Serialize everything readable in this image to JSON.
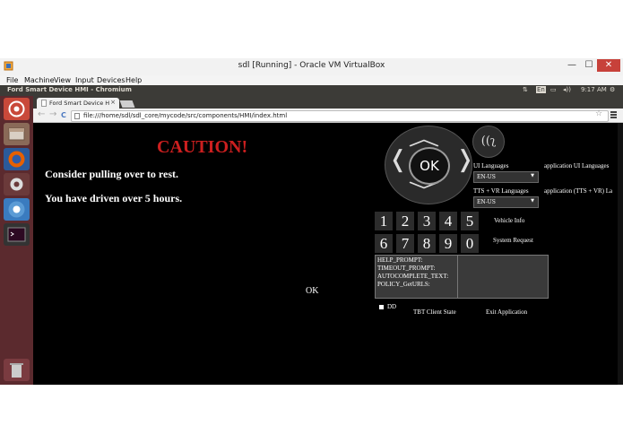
{
  "vbox": {
    "title": "sdl [Running] - Oracle VM VirtualBox",
    "menu": [
      "File",
      "Machine",
      "View",
      "Input",
      "Devices",
      "Help"
    ],
    "min_glyph": "—",
    "max_glyph": "☐",
    "close_glyph": "✕"
  },
  "ubuntu": {
    "window_title": "Ford Smart Device HMI - Chromium",
    "keyboard_indicator": "En",
    "clock": "9:17 AM",
    "network_glyph": "⇅",
    "battery_glyph": "▭",
    "volume_glyph": "◂))",
    "settings_glyph": "⚙"
  },
  "browser": {
    "tab_title": "Ford Smart Device H",
    "tab_close": "×",
    "back": "←",
    "forward": "→",
    "reload": "C",
    "url": "file:///home/sdl/sdl_core/mycode/src/components/HMI/index.html",
    "star": "☆"
  },
  "hmi": {
    "alert_title": "CAUTION!",
    "alert_line1": "Consider pulling over to rest.",
    "alert_line2": "You have driven over 5 hours.",
    "alert_ok": "OK",
    "dpad_ok": "OK",
    "voice_glyph": "((ʅ",
    "ui_languages_label": "UI Languages",
    "ui_language_value": "EN-US",
    "app_ui_languages_label": "application UI Languages",
    "tts_vr_label": "TTS + VR Languages",
    "tts_vr_value": "EN-US",
    "app_tts_vr_label": "application (TTS + VR) La",
    "digits_row1": [
      "1",
      "2",
      "3",
      "4",
      "5"
    ],
    "digits_row2": [
      "6",
      "7",
      "8",
      "9",
      "0"
    ],
    "vehicle_info": "Vehicle Info",
    "system_request": "System Request",
    "prompts": [
      "HELP_PROMPT:",
      "TIMEOUT_PROMPT:",
      "AUTOCOMPLETE_TEXT:",
      "POLICY_GetURLS:"
    ],
    "dd_label": "DD",
    "tbt_client_state": "TBT Client State",
    "exit_application": "Exit Application"
  }
}
